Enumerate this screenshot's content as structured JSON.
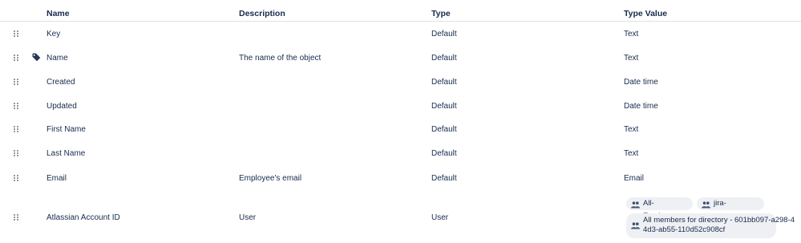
{
  "table": {
    "columns": {
      "name": "Name",
      "description": "Description",
      "type": "Type",
      "type_value": "Type Value"
    },
    "rows": [
      {
        "name": "Key",
        "description": "",
        "type": "Default",
        "type_value": "Text"
      },
      {
        "name": "Name",
        "description": "The name of the object",
        "type": "Default",
        "type_value": "Text",
        "label_icon": "tag-icon"
      },
      {
        "name": "Created",
        "description": "",
        "type": "Default",
        "type_value": "Date time"
      },
      {
        "name": "Updated",
        "description": "",
        "type": "Default",
        "type_value": "Date time"
      },
      {
        "name": "First Name",
        "description": "",
        "type": "Default",
        "type_value": "Text"
      },
      {
        "name": "Last Name",
        "description": "",
        "type": "Default",
        "type_value": "Text"
      },
      {
        "name": "Email",
        "description": "Employee's email",
        "type": "Default",
        "type_value": "Email"
      },
      {
        "name": "Atlassian Account ID",
        "description": "User",
        "type": "User",
        "type_value_groups": [
          {
            "icon": "group-icon",
            "label": "All-Employees"
          },
          {
            "icon": "group-icon",
            "label": "jira-contractor"
          },
          {
            "icon": "group-icon",
            "label": "All members for directory - 601bb097-a298-4",
            "label_line2": "4d3-ab55-110d52c908cf"
          }
        ]
      }
    ]
  }
}
